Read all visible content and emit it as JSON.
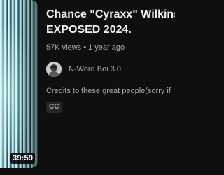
{
  "video": {
    "duration": "39:59",
    "title_line1": "Chance \"Cyraxx\" Wilkins Caug",
    "title_line2": "EXPOSED 2024.",
    "views": "57K views",
    "separator": "•",
    "age": "1 year ago",
    "channel_name": "N-Word Boi 3.0",
    "description": "Credits to these great people(sorry if I mista",
    "badge": "CC"
  },
  "colors": {
    "background": "#0f0f0f",
    "title": "#f1f1f1",
    "secondary_text": "#aaaaaa",
    "badge_bg": "#272727"
  },
  "icons": {
    "avatar": "channel-avatar-icon"
  }
}
